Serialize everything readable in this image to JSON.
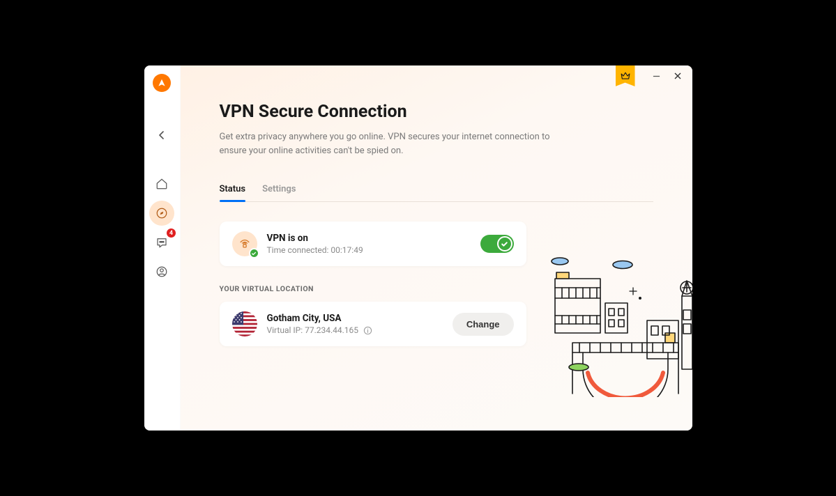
{
  "sidebar": {
    "notification_count": "4"
  },
  "page": {
    "title": "VPN Secure Connection",
    "subtitle": "Get extra privacy anywhere you go online. VPN secures your internet connection to ensure your online activities can't be spied on."
  },
  "tabs": {
    "status": "Status",
    "settings": "Settings"
  },
  "vpn_status": {
    "title": "VPN is on",
    "time_prefix": "Time connected: ",
    "time_value": "00:17:49"
  },
  "location": {
    "section_label": "YOUR VIRTUAL LOCATION",
    "city": "Gotham City, USA",
    "ip_prefix": "Virtual IP: ",
    "ip_value": "77.234.44.165",
    "change_button": "Change"
  }
}
